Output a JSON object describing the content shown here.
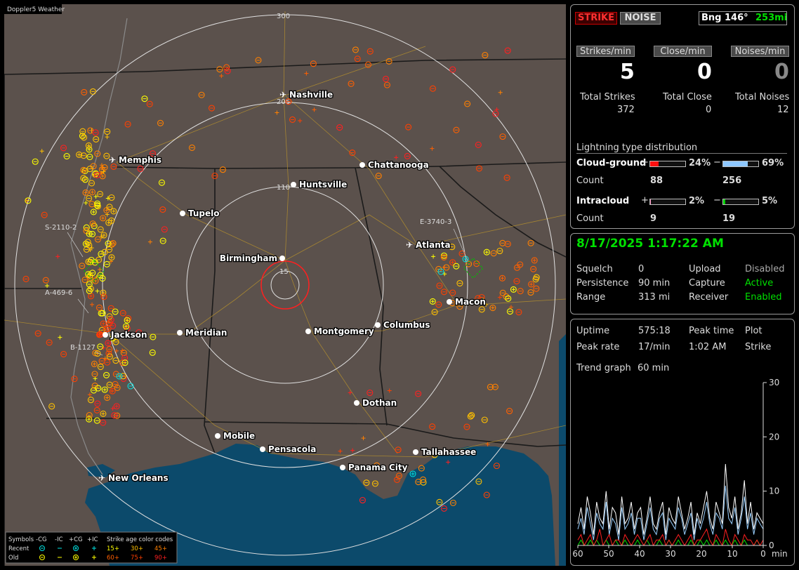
{
  "map": {
    "app_title": "Doppler5 Weather",
    "range_labels": [
      "300",
      "205",
      "110",
      "15"
    ],
    "cities": [
      {
        "name": "Nashville",
        "kind": "airport"
      },
      {
        "name": "Memphis",
        "kind": "airport"
      },
      {
        "name": "Chattanooga",
        "kind": "dot"
      },
      {
        "name": "Huntsville",
        "kind": "dot"
      },
      {
        "name": "Tupelo",
        "kind": "dot"
      },
      {
        "name": "Atlanta",
        "kind": "airport"
      },
      {
        "name": "Birmingham",
        "kind": "dot"
      },
      {
        "name": "Macon",
        "kind": "dot"
      },
      {
        "name": "Jackson",
        "kind": "dot"
      },
      {
        "name": "Meridian",
        "kind": "dot"
      },
      {
        "name": "Montgomery",
        "kind": "dot"
      },
      {
        "name": "Columbus",
        "kind": "dot"
      },
      {
        "name": "Dothan",
        "kind": "dot"
      },
      {
        "name": "Mobile",
        "kind": "dot"
      },
      {
        "name": "Pensacola",
        "kind": "dot"
      },
      {
        "name": "Tallahassee",
        "kind": "dot"
      },
      {
        "name": "Panama City",
        "kind": "dot"
      },
      {
        "name": "New Orleans",
        "kind": "airport"
      }
    ],
    "cell_labels": [
      "S-2110-2",
      "E-3740-3",
      "A-469-6",
      "B-1127"
    ],
    "legend": {
      "symbols_label": "Symbols",
      "headers": [
        "-CG",
        "-IC",
        "+CG",
        "+IC"
      ],
      "age_title": "Strike age color codes",
      "rows": [
        {
          "label": "Recent",
          "ages": [
            "15+",
            "30+",
            "45+"
          ]
        },
        {
          "label": "Old",
          "ages": [
            "60+",
            "75+",
            "90+"
          ]
        }
      ],
      "age_colors": [
        "#ffff00",
        "#ffc000",
        "#ff8000",
        "#ff6000",
        "#ff4000",
        "#ff2020"
      ]
    }
  },
  "status": {
    "strike_btn": "STRIKE",
    "noise_btn": "NOISE",
    "bearing": "Bng 146°",
    "distance": "253mi",
    "strikes_min_label": "Strikes/min",
    "close_min_label": "Close/min",
    "noises_min_label": "Noises/min",
    "strikes_min": "5",
    "close_min": "0",
    "noises_min": "0",
    "total_strikes_label": "Total Strikes",
    "total_close_label": "Total Close",
    "total_noises_label": "Total Noises",
    "total_strikes": "372",
    "total_close": "0",
    "total_noises": "12",
    "dist_title": "Lightning type distribution",
    "cg_label": "Cloud-ground",
    "ic_label": "Intracloud",
    "count_label": "Count",
    "plus": "+",
    "minus": "−",
    "cg_pos_pct": "24%",
    "cg_pos_frac": 0.24,
    "cg_neg_pct": "69%",
    "cg_neg_frac": 0.69,
    "ic_pos_pct": "2%",
    "ic_pos_frac": 0.02,
    "ic_neg_pct": "5%",
    "ic_neg_frac": 0.05,
    "cg_pos_count": "88",
    "cg_neg_count": "256",
    "ic_pos_count": "9",
    "ic_neg_count": "19"
  },
  "info": {
    "datetime": "8/17/2025 1:17:22 AM",
    "rows": [
      [
        "Squelch",
        "0",
        "Upload",
        "Disabled"
      ],
      [
        "Persistence",
        "90 min",
        "Capture",
        "Active"
      ],
      [
        "Range",
        "313 mi",
        "Receiver",
        "Enabled"
      ]
    ]
  },
  "trend": {
    "uptime_label": "Uptime",
    "uptime": "575:18",
    "peak_time_label": "Peak time",
    "peak_time": "1:02 AM",
    "plot_label": "Plot",
    "plot": "Strike",
    "peak_rate_label": "Peak rate",
    "peak_rate": "17/min",
    "graph_label": "Trend graph",
    "graph_span": "60 min",
    "y_ticks": [
      "30",
      "20",
      "10",
      "0"
    ],
    "x_ticks": [
      "60",
      "50",
      "40",
      "30",
      "20",
      "10",
      "0"
    ],
    "x_unit": "min"
  },
  "chart_data": {
    "type": "line",
    "xlabel": "min",
    "xlim": [
      60,
      0
    ],
    "ylim": [
      0,
      30
    ],
    "series": [
      {
        "color": "#ffffff",
        "values": [
          4,
          7,
          3,
          9,
          6,
          2,
          8,
          5,
          4,
          10,
          3,
          7,
          6,
          2,
          9,
          4,
          5,
          8,
          3,
          6,
          7,
          2,
          5,
          9,
          4,
          3,
          6,
          8,
          2,
          7,
          5,
          4,
          9,
          6,
          3,
          5,
          8,
          2,
          6,
          4,
          7,
          10,
          5,
          3,
          8,
          6,
          4,
          15,
          7,
          5,
          9,
          3,
          6,
          12,
          4,
          8,
          3,
          6,
          5,
          4
        ]
      },
      {
        "color": "#9ad0ff",
        "values": [
          3,
          5,
          2,
          7,
          4,
          1,
          6,
          4,
          3,
          8,
          2,
          5,
          4,
          1,
          7,
          3,
          4,
          6,
          2,
          5,
          5,
          1,
          4,
          7,
          3,
          2,
          5,
          6,
          1,
          5,
          4,
          3,
          7,
          5,
          2,
          4,
          6,
          1,
          5,
          3,
          5,
          8,
          4,
          2,
          6,
          5,
          3,
          11,
          5,
          4,
          7,
          2,
          5,
          9,
          3,
          6,
          2,
          5,
          4,
          3
        ]
      },
      {
        "color": "#ff2020",
        "values": [
          1,
          2,
          0,
          1,
          2,
          0,
          1,
          3,
          0,
          1,
          2,
          0,
          1,
          1,
          0,
          2,
          1,
          0,
          1,
          2,
          1,
          0,
          1,
          2,
          0,
          1,
          1,
          2,
          0,
          1,
          0,
          1,
          2,
          1,
          0,
          1,
          2,
          0,
          1,
          1,
          2,
          3,
          1,
          0,
          2,
          1,
          0,
          3,
          1,
          0,
          2,
          1,
          0,
          2,
          1,
          1,
          0,
          1,
          0,
          1
        ]
      },
      {
        "color": "#00e000",
        "values": [
          0,
          1,
          0,
          0,
          1,
          0,
          1,
          0,
          0,
          1,
          0,
          0,
          1,
          0,
          0,
          1,
          0,
          0,
          0,
          1,
          0,
          0,
          1,
          0,
          0,
          0,
          1,
          0,
          0,
          1,
          0,
          0,
          1,
          0,
          0,
          0,
          1,
          0,
          0,
          1,
          0,
          1,
          0,
          0,
          1,
          0,
          0,
          1,
          0,
          0,
          1,
          0,
          0,
          1,
          0,
          0,
          0,
          1,
          0,
          0
        ]
      }
    ]
  }
}
